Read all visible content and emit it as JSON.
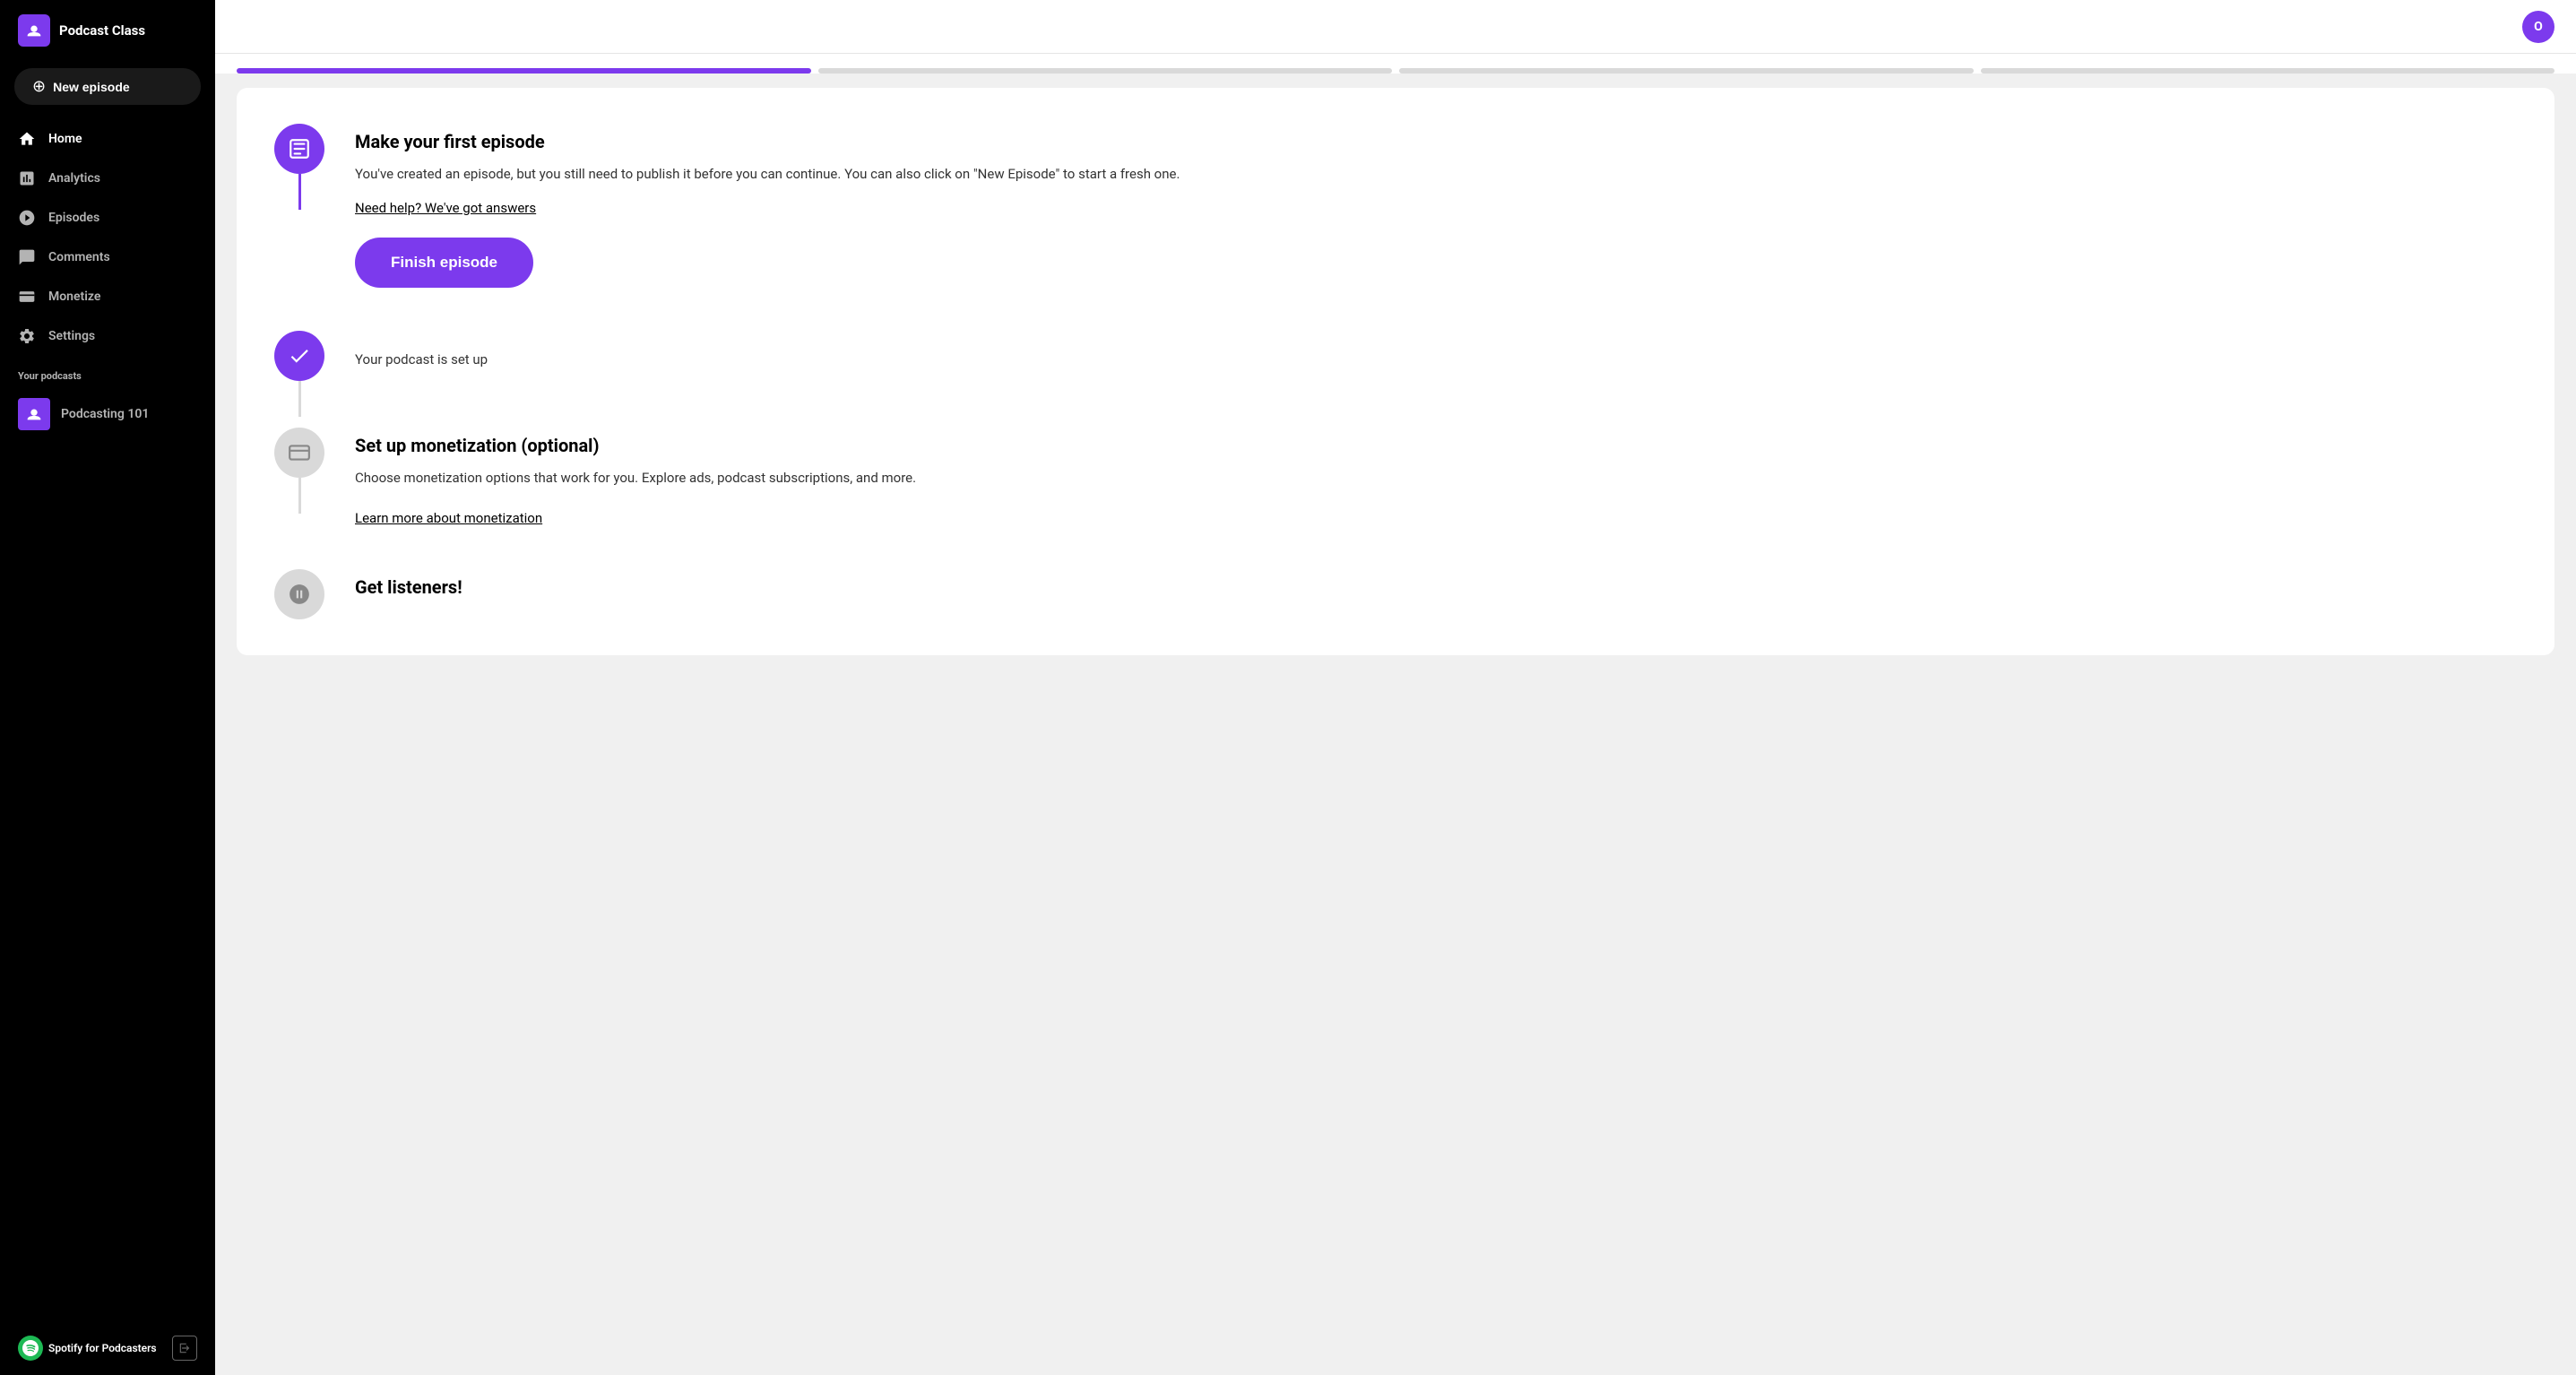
{
  "sidebar": {
    "app_title": "Podcast Class",
    "new_episode_label": "New episode",
    "nav_items": [
      {
        "id": "home",
        "label": "Home",
        "icon": "home"
      },
      {
        "id": "analytics",
        "label": "Analytics",
        "icon": "analytics"
      },
      {
        "id": "episodes",
        "label": "Episodes",
        "icon": "episodes"
      },
      {
        "id": "comments",
        "label": "Comments",
        "icon": "comments"
      },
      {
        "id": "monetize",
        "label": "Monetize",
        "icon": "monetize"
      },
      {
        "id": "settings",
        "label": "Settings",
        "icon": "settings"
      }
    ],
    "your_podcasts_label": "Your podcasts",
    "podcast_name": "Podcasting 101",
    "footer": {
      "spotify_label": "Spotify for Podcasters"
    }
  },
  "header": {
    "user_avatar_letter": "O"
  },
  "progress_bar": {
    "segments": [
      {
        "active": true
      },
      {
        "active": false
      },
      {
        "active": false
      },
      {
        "active": false
      }
    ]
  },
  "timeline": {
    "items": [
      {
        "id": "first-episode",
        "state": "active",
        "title": "Make your first episode",
        "description": "You've created an episode, but you still need to publish it before you can continue. You can also click on \"New Episode\" to start a fresh one.",
        "link_label": "Need help? We've got answers",
        "action_label": "Finish episode",
        "line_color": "purple"
      },
      {
        "id": "podcast-setup",
        "state": "completed",
        "status_text": "Your podcast is set up",
        "line_color": "gray"
      },
      {
        "id": "monetization",
        "state": "inactive",
        "title": "Set up monetization (optional)",
        "description": "Choose monetization options that work for you. Explore ads, podcast subscriptions, and more.",
        "link_label": "Learn more about monetization",
        "line_color": "gray"
      },
      {
        "id": "get-listeners",
        "state": "inactive",
        "title": "Get listeners!"
      }
    ]
  }
}
